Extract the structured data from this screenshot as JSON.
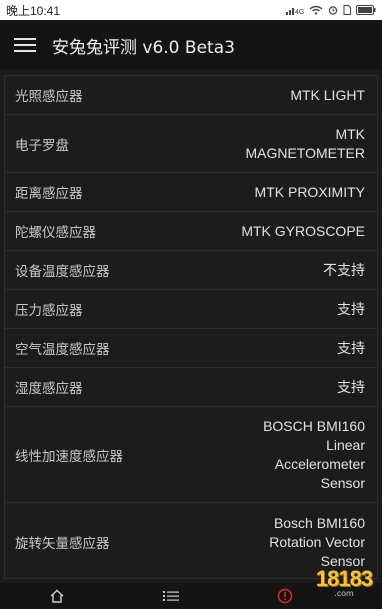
{
  "status_bar": {
    "time": "晚上10:41",
    "signal": "signal-icon",
    "wifi": "wifi-icon",
    "alarm": "alarm-icon",
    "sim": "sim-icon",
    "battery": "battery-icon"
  },
  "app_bar": {
    "menu_icon": "hamburger-icon",
    "title": "安兔兔评测 v6.0 Beta3"
  },
  "sensors": [
    {
      "label": "光照感应器",
      "value": "MTK LIGHT"
    },
    {
      "label": "电子罗盘",
      "value": "MTK MAGNETOMETER"
    },
    {
      "label": "距离感应器",
      "value": "MTK PROXIMITY"
    },
    {
      "label": "陀螺仪感应器",
      "value": "MTK GYROSCOPE"
    },
    {
      "label": "设备温度感应器",
      "value": "不支持"
    },
    {
      "label": "压力感应器",
      "value": "支持"
    },
    {
      "label": "空气温度感应器",
      "value": "支持"
    },
    {
      "label": "湿度感应器",
      "value": "支持"
    },
    {
      "label": "线性加速度感应器",
      "value": "BOSCH BMI160 Linear Accelerometer Sensor"
    },
    {
      "label": "旋转矢量感应器",
      "value": "Bosch BMI160 Rotation Vector Sensor"
    }
  ],
  "bottom_nav": {
    "items": [
      "home-icon",
      "list-icon",
      "alert-icon"
    ],
    "active_color": "#e02b2b"
  },
  "watermark": {
    "text": "18183",
    "sub": ".com"
  },
  "colors": {
    "background": "#1b1b1b",
    "app_bar": "#141414",
    "status_bar": "#ffffff",
    "divider": "#2c2c2c",
    "watermark": "#f3c341"
  }
}
